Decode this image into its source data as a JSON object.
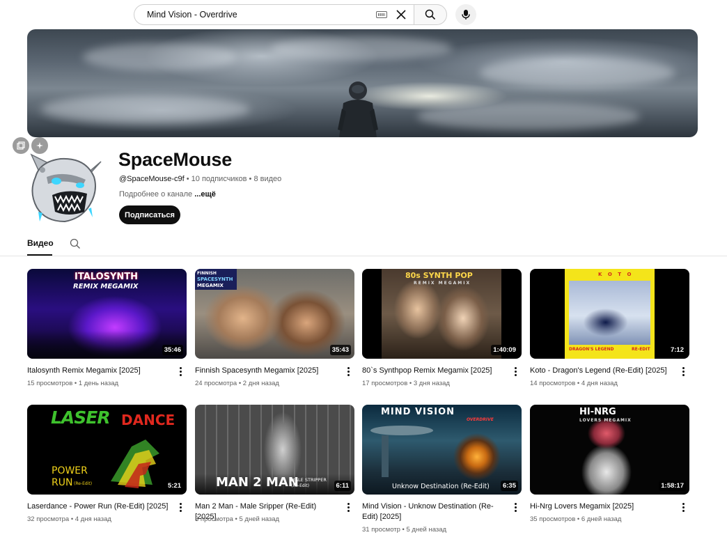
{
  "search": {
    "query": "Mind Vision - Overdrive"
  },
  "channel": {
    "name": "SpaceMouse",
    "handle": "@SpaceMouse-c9f",
    "meta_rest": " • 10 подписчиков • 8 видео",
    "about_prefix": "Подробнее о канале ",
    "about_more": "...ещё",
    "subscribe_label": "Подписаться"
  },
  "tabs": {
    "videos_label": "Видео"
  },
  "videos": [
    {
      "title": "Italosynth Remix Megamix [2025]",
      "meta": "15 просмотров • 1 день назад",
      "duration": "35:46",
      "thumb_text": [
        "ITALOSYNTH",
        "REMIX MEGAMIX"
      ]
    },
    {
      "title": "Finnish Spacesynth Megamix [2025]",
      "meta": "24 просмотра • 2 дня назад",
      "duration": "35:43",
      "thumb_text": [
        "FINNISH",
        "SPACESYNTH",
        "MEGAMIX"
      ]
    },
    {
      "title": "80`s Synthpop Remix Megamix [2025]",
      "meta": "17 просмотров • 3 дня назад",
      "duration": "1:40:09",
      "thumb_text": [
        "80s SYNTH POP",
        "REMIX MEGAMIX"
      ]
    },
    {
      "title": "Koto - Dragon's Legend (Re-Edit) [2025]",
      "meta": "14 просмотров • 4 дня назад",
      "duration": "7:12",
      "thumb_text": [
        "K O T O",
        "DRAGON'S LEGEND",
        "RE-EDIT"
      ]
    },
    {
      "title": "Laserdance - Power Run (Re-Edit) [2025]",
      "meta": "32 просмотра • 4 дня назад",
      "duration": "5:21",
      "thumb_text": [
        "LASER",
        "DANCE",
        "POWER",
        "RUN",
        "(Re-Edit)"
      ]
    },
    {
      "title": "Man 2 Man - Male Sripper (Re-Edit) [2025]",
      "meta": "3 просмотра • 5 дней назад",
      "duration": "6:11",
      "thumb_text": [
        "MAN 2 MAN",
        "MALE STRIPPER",
        "(Re-Edit)"
      ]
    },
    {
      "title": "Mind Vision - Unknow Destination (Re-Edit) [2025]",
      "meta": "31 просмотр • 5 дней назад",
      "duration": "6:35",
      "thumb_text": [
        "MIND VISION",
        "OVERDRIVE",
        "Unknow Destination (Re-Edit)"
      ]
    },
    {
      "title": "Hi-Nrg Lovers Megamix [2025]",
      "meta": "35 просмотров • 6 дней назад",
      "duration": "1:58:17",
      "thumb_text": [
        "HI-NRG",
        "LOVERS MEGAMIX"
      ]
    }
  ],
  "icons": {
    "search": "search-icon",
    "clear": "close-icon",
    "keyboard": "keyboard-icon",
    "mic": "microphone-icon",
    "menu": "more-vert-icon"
  },
  "colors": {
    "subscribe_bg": "#0f0f0f",
    "meta_text": "#606060"
  }
}
